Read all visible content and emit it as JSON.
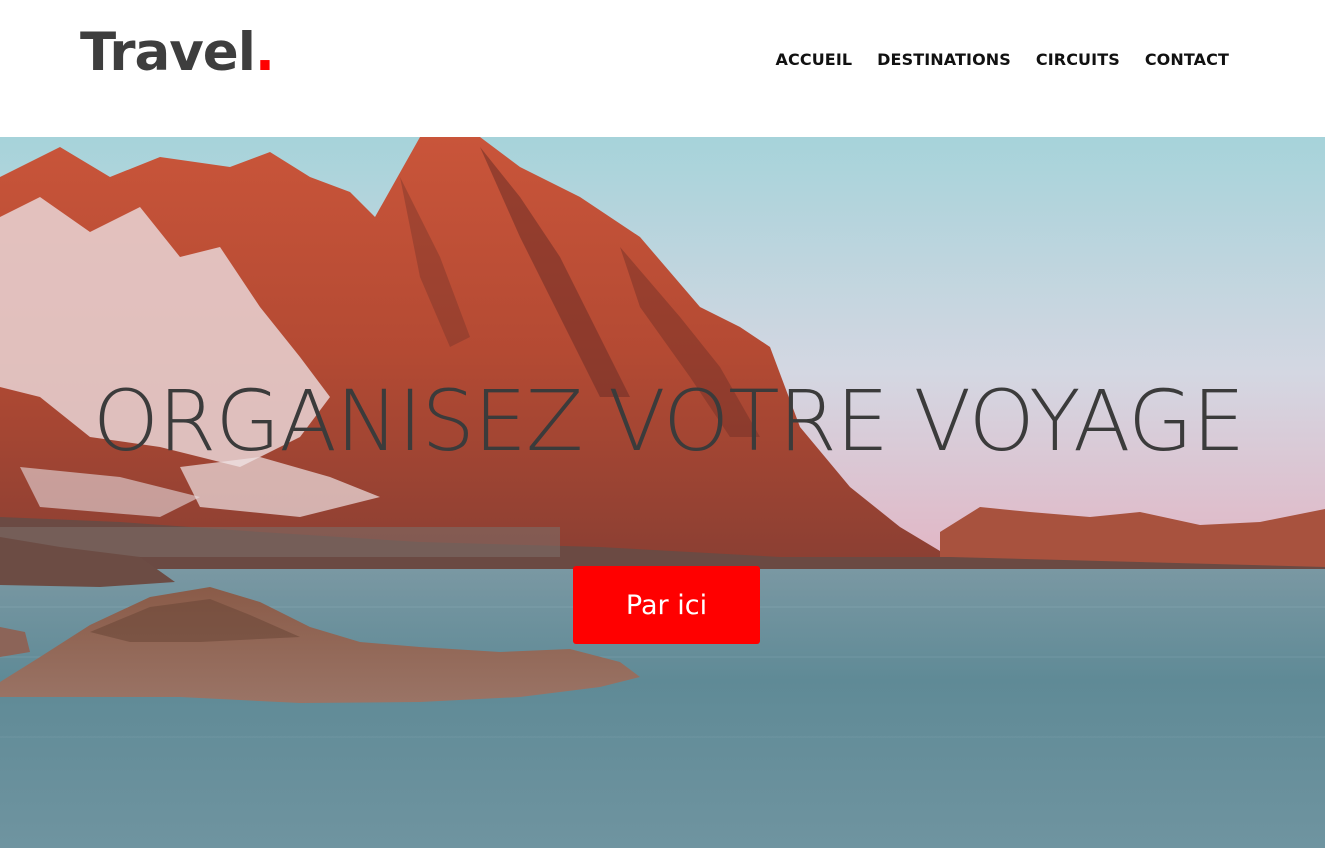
{
  "header": {
    "logo_text": "Travel",
    "logo_dot": ".",
    "nav": [
      {
        "label": "ACCUEIL"
      },
      {
        "label": "DESTINATIONS"
      },
      {
        "label": "CIRCUITS"
      },
      {
        "label": "CONTACT"
      }
    ]
  },
  "hero": {
    "title": "ORGANISEZ VOTRE VOYAGE",
    "cta_label": "Par ici",
    "background_image": "fjord-mountains-photo"
  },
  "colors": {
    "accent": "#ff0000",
    "text_dark": "#3e3e3e",
    "nav_text": "#111111"
  }
}
